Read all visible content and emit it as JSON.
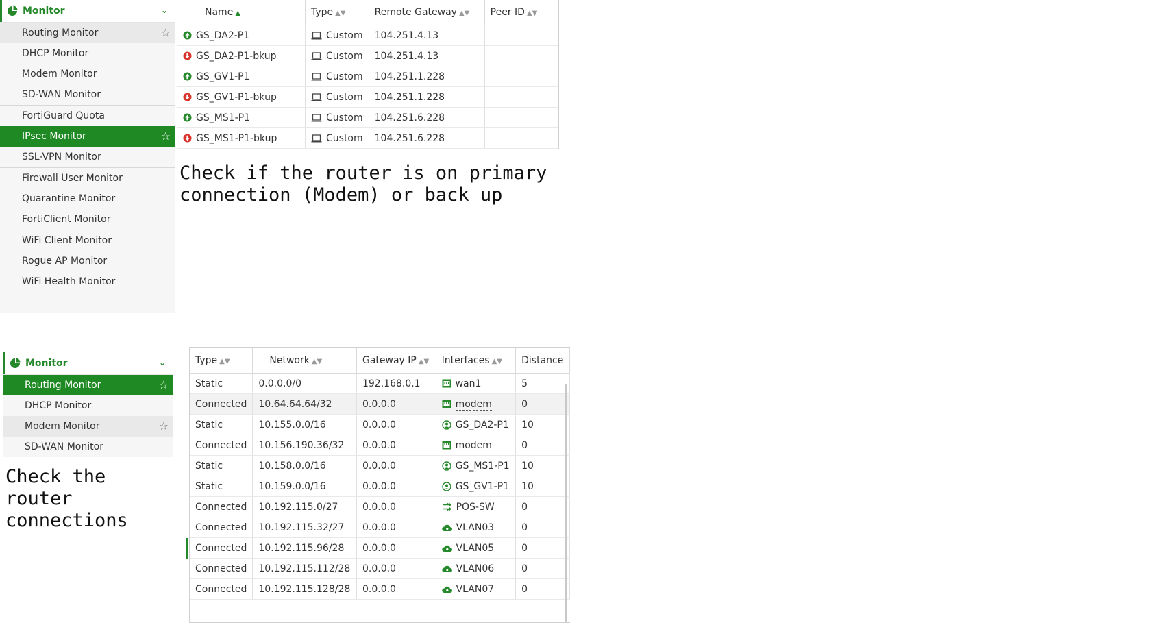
{
  "sidebar_top": {
    "header": "Monitor",
    "items": [
      {
        "label": "Routing Monitor",
        "starred": true,
        "state": "hover"
      },
      {
        "label": "DHCP Monitor"
      },
      {
        "label": "Modem Monitor"
      },
      {
        "label": "SD-WAN Monitor"
      },
      {
        "label": "FortiGuard Quota",
        "sep": true
      },
      {
        "label": "IPsec Monitor",
        "starred": true,
        "state": "active"
      },
      {
        "label": "SSL-VPN Monitor"
      },
      {
        "label": "Firewall User Monitor",
        "sep": true
      },
      {
        "label": "Quarantine Monitor"
      },
      {
        "label": "FortiClient Monitor"
      },
      {
        "label": "WiFi Client Monitor",
        "sep": true
      },
      {
        "label": "Rogue AP Monitor"
      },
      {
        "label": "WiFi Health Monitor"
      }
    ]
  },
  "ipsec_table": {
    "headers": [
      "Name",
      "Type",
      "Remote Gateway",
      "Peer ID"
    ],
    "rows": [
      {
        "status": "up",
        "name": "GS_DA2-P1",
        "type": "Custom",
        "gateway": "104.251.4.13",
        "peer": ""
      },
      {
        "status": "down",
        "name": "GS_DA2-P1-bkup",
        "type": "Custom",
        "gateway": "104.251.4.13",
        "peer": ""
      },
      {
        "status": "up",
        "name": "GS_GV1-P1",
        "type": "Custom",
        "gateway": "104.251.1.228",
        "peer": ""
      },
      {
        "status": "down",
        "name": "GS_GV1-P1-bkup",
        "type": "Custom",
        "gateway": "104.251.1.228",
        "peer": ""
      },
      {
        "status": "up",
        "name": "GS_MS1-P1",
        "type": "Custom",
        "gateway": "104.251.6.228",
        "peer": ""
      },
      {
        "status": "down",
        "name": "GS_MS1-P1-bkup",
        "type": "Custom",
        "gateway": "104.251.6.228",
        "peer": ""
      }
    ]
  },
  "note_top": "Check if the router is on primary\nconnection (Modem) or back up",
  "sidebar_bottom": {
    "header": "Monitor",
    "items": [
      {
        "label": "Routing Monitor",
        "starred": true,
        "state": "active"
      },
      {
        "label": "DHCP Monitor"
      },
      {
        "label": "Modem Monitor",
        "starred": true,
        "state": "hover"
      },
      {
        "label": "SD-WAN Monitor"
      }
    ]
  },
  "note_bottom": "Check the\nrouter\nconnections",
  "routing_table": {
    "headers": [
      "Type",
      "Network",
      "Gateway IP",
      "Interfaces",
      "Distance"
    ],
    "rows": [
      {
        "type": "Static",
        "network": "0.0.0.0/0",
        "gateway": "192.168.0.1",
        "iface": "wan1",
        "icon": "port",
        "distance": "5"
      },
      {
        "type": "Connected",
        "network": "10.64.64.64/32",
        "gateway": "0.0.0.0",
        "iface": "modem",
        "icon": "port",
        "distance": "0",
        "hover": true
      },
      {
        "type": "Static",
        "network": "10.155.0.0/16",
        "gateway": "0.0.0.0",
        "iface": "GS_DA2-P1",
        "icon": "tunnel",
        "distance": "10"
      },
      {
        "type": "Connected",
        "network": "10.156.190.36/32",
        "gateway": "0.0.0.0",
        "iface": "modem",
        "icon": "port",
        "distance": "0"
      },
      {
        "type": "Static",
        "network": "10.158.0.0/16",
        "gateway": "0.0.0.0",
        "iface": "GS_MS1-P1",
        "icon": "tunnel",
        "distance": "10"
      },
      {
        "type": "Static",
        "network": "10.159.0.0/16",
        "gateway": "0.0.0.0",
        "iface": "GS_GV1-P1",
        "icon": "tunnel",
        "distance": "10"
      },
      {
        "type": "Connected",
        "network": "10.192.115.0/27",
        "gateway": "0.0.0.0",
        "iface": "POS-SW",
        "icon": "switch",
        "distance": "0"
      },
      {
        "type": "Connected",
        "network": "10.192.115.32/27",
        "gateway": "0.0.0.0",
        "iface": "VLAN03",
        "icon": "cloud",
        "distance": "0"
      },
      {
        "type": "Connected",
        "network": "10.192.115.96/28",
        "gateway": "0.0.0.0",
        "iface": "VLAN05",
        "icon": "cloud",
        "distance": "0"
      },
      {
        "type": "Connected",
        "network": "10.192.115.112/28",
        "gateway": "0.0.0.0",
        "iface": "VLAN06",
        "icon": "cloud",
        "distance": "0"
      },
      {
        "type": "Connected",
        "network": "10.192.115.128/28",
        "gateway": "0.0.0.0",
        "iface": "VLAN07",
        "icon": "cloud",
        "distance": "0"
      }
    ]
  },
  "colors": {
    "accent": "#25882a",
    "active_bg": "#1f8a23",
    "down": "#d9342b"
  }
}
